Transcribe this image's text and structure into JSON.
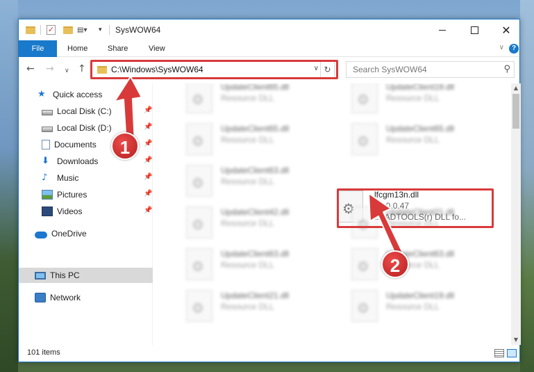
{
  "window": {
    "title": "SysWOW64",
    "ribbon_tabs": [
      "File",
      "Home",
      "Share",
      "View"
    ],
    "help_glyph": "?"
  },
  "navbar": {
    "address": "C:\\Windows\\SysWOW64",
    "search_placeholder": "Search SysWOW64"
  },
  "sidebar": {
    "items": [
      {
        "label": "Quick access",
        "icon": "star-icon"
      },
      {
        "label": "Local Disk (C:)",
        "icon": "disk-icon",
        "pinned": true
      },
      {
        "label": "Local Disk (D:)",
        "icon": "disk-icon",
        "pinned": true
      },
      {
        "label": "Documents",
        "icon": "documents-icon",
        "pinned": true
      },
      {
        "label": "Downloads",
        "icon": "download-icon",
        "pinned": true
      },
      {
        "label": "Music",
        "icon": "music-icon",
        "pinned": true
      },
      {
        "label": "Pictures",
        "icon": "pictures-icon",
        "pinned": true
      },
      {
        "label": "Videos",
        "icon": "videos-icon",
        "pinned": true
      },
      {
        "label": "OneDrive",
        "icon": "cloud-icon"
      },
      {
        "label": "This PC",
        "icon": "computer-icon",
        "selected": true
      },
      {
        "label": "Network",
        "icon": "network-icon"
      }
    ]
  },
  "files": {
    "left_column": [
      {
        "name": "UpdateClient65.dll",
        "desc": "Resource DLL"
      },
      {
        "name": "UpdateClient65.dll",
        "desc": "Resource DLL"
      },
      {
        "name": "UpdateClient63.dll",
        "desc": "Resource DLL"
      },
      {
        "name": "UpdateClient42.dll",
        "desc": "Resource DLL"
      },
      {
        "name": "UpdateClient63.dll",
        "desc": "Resource DLL"
      },
      {
        "name": "UpdateClient21.dll",
        "desc": "Resource DLL"
      }
    ],
    "right_column": [
      {
        "name": "UpdateClient19.dll",
        "desc": "Resource DLL"
      },
      {
        "name": "UpdateClient65.dll",
        "desc": "Resource DLL"
      },
      {
        "name": "lfcgm13n.dll",
        "desc": "13.0.0.47",
        "desc2": "LEADTOOLS(r) DLL fo...",
        "highlighted": true
      },
      {
        "name": "UpdateClient21.dll",
        "desc": "Resource DLL"
      },
      {
        "name": "UpdateClient63.dll",
        "desc": "Resource DLL"
      },
      {
        "name": "UpdateClient19.dll",
        "desc": "Resource DLL"
      }
    ]
  },
  "status": {
    "item_count": "101 items"
  },
  "callouts": {
    "step1": "1",
    "step2": "2",
    "color": "#d83a3a"
  }
}
